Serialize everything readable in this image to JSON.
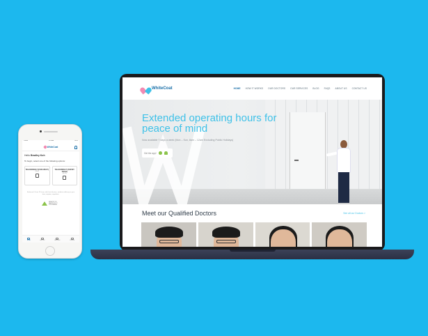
{
  "phone": {
    "status": {
      "left": "Carrier",
      "center": "9:41 AM",
      "right": "100%"
    },
    "logo_text": "WhiteCoat",
    "greeting_prefix": "Hello",
    "user_name": "Bradley Koh",
    "prompt": "To begin, select one of the following options:",
    "cards": [
      {
        "title": "TELECONSULT (FOR ADULT)",
        "subtitle": "(18+)"
      },
      {
        "title": "TELECONSULT (FOR MY CHILD)",
        "subtitle": "(2-17)"
      }
    ],
    "note": "Endorsed. Gives 24 hours with local doctors, medicine delivery to your door, anytime, anywhere.",
    "brand_text": "MINISTRY OF HEALTH PILOT PROGRAMME",
    "tabs": [
      "HOME",
      "HISTORY",
      "RECORDS",
      "PROFILE"
    ]
  },
  "site": {
    "brand": "WhiteCoat",
    "menu": [
      "HOME",
      "HOW IT WORKS",
      "OUR DOCTORS",
      "OUR SERVICES",
      "BLOG",
      "FAQS",
      "ABOUT US",
      "CONTACT US"
    ],
    "active_menu": "HOME",
    "hero_title": "Extended operating hours for peace of mind",
    "hero_subtitle": "Now available 7 days a week (Mon – Sun, 8am – 12am Excluding Public Holidays)",
    "get_app_label": "Get the app!",
    "doctors_title": "Meet our Qualified Doctors",
    "doctors_link": "See all our Doctors >",
    "doctor_count": 4
  },
  "colors": {
    "background": "#1cb8ee",
    "accent": "#3ec1e8",
    "brand_blue": "#1a6fa8",
    "logo_pink": "#f28ab2",
    "store_green": "#8bc34a"
  }
}
